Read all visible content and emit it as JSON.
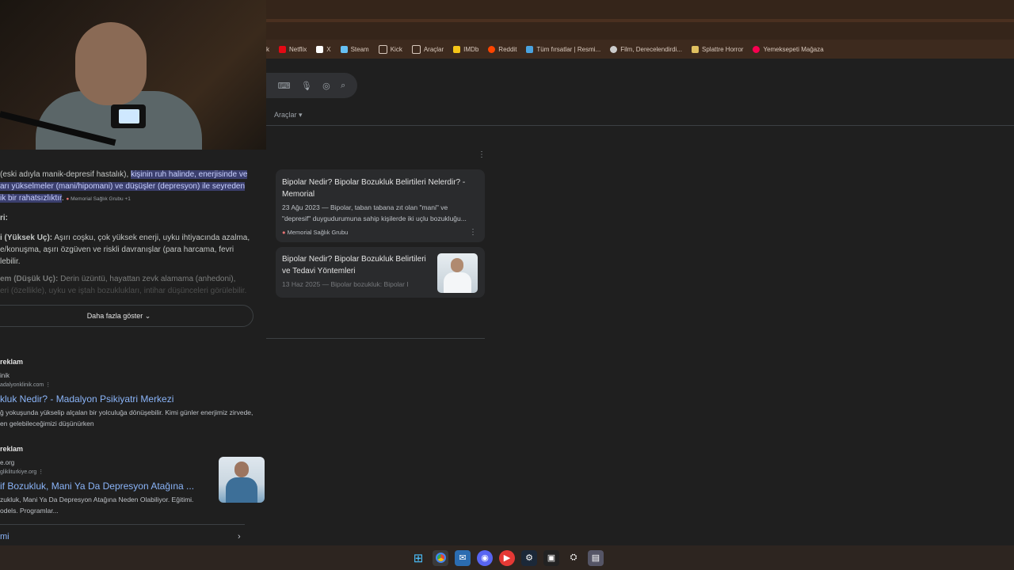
{
  "bookmarks": [
    {
      "label": "k",
      "color": "#d9c9bd"
    },
    {
      "label": "Netflix",
      "color": "#e50914"
    },
    {
      "label": "X",
      "color": "#ffffff"
    },
    {
      "label": "Steam",
      "color": "#66c0f4"
    },
    {
      "label": "Kick",
      "color": "#53fc18"
    },
    {
      "label": "Araçlar",
      "color": "#d9c9bd"
    },
    {
      "label": "IMDb",
      "color": "#f5c518"
    },
    {
      "label": "Reddit",
      "color": "#ff4500"
    },
    {
      "label": "Tüm fırsatlar | Resmi...",
      "color": "#4aa3df"
    },
    {
      "label": "Film, Derecelendirdi...",
      "color": "#cccccc"
    },
    {
      "label": "Splattre Horror",
      "color": "#e0c060"
    },
    {
      "label": "Yemeksepeti Mağaza",
      "color": "#fa0050"
    }
  ],
  "search": {
    "tools_label": "Araçlar",
    "icons": [
      "keyboard-icon",
      "mic-icon",
      "camera-icon",
      "search-icon"
    ]
  },
  "overview": {
    "line1_plain": "(eski adıyla manik-depresif hastalık), ",
    "line1_hl": "kişinin ruh halinde, enerjisinde ve",
    "line2_hl": "arı yükselmeler (mani/hipomani) ve düşüşler (depresyon) ile seyreden",
    "line3_hl": "ik bir rahatsızlıktır",
    "source_chip": "Memorial Sağlık Grubu +1",
    "heading": "ri:",
    "mania_label": "i (Yüksek Uç):",
    "mania_text": " Aşırı coşku, çok yüksek enerji, uyku ihtiyacında azalma,",
    "mania_line2": "e/konuşma, aşırı özgüven ve riskli davranışlar (para harcama, fevri",
    "mania_line3": "lebilir.",
    "dep_label": "em (Düşük Uç):",
    "dep_text": " Derin üzüntü, hayattan zevk alamama (anhedoni),",
    "dep_line2": "eri (özellikle), uyku ve iştah bozuklukları, intihar düşünceleri görülebilir.",
    "show_more": "Daha fazla göster"
  },
  "ads": [
    {
      "label": "reklam",
      "site": "inik",
      "url": "adalyonklinik.com",
      "title": "kluk Nedir? - Madalyon Psikiyatri Merkezi",
      "desc1": "ğ yokuşunda yükselip alçalan bir yolculuğa dönüşebilir. Kimi günler enerjimiz zirvede,",
      "desc2": "en gelebileceğimizi düşünürken"
    },
    {
      "label": "reklam",
      "site": "e.org",
      "url": "glikliturkiye.org",
      "title": "if Bozukluk, Mani Ya Da Depresyon Atağına ...",
      "desc1": "zukluk, Mani Ya Da Depresyon Atağına Neden Olabiliyor. Eğitimi.",
      "desc2": "odels. Programlar..."
    }
  ],
  "bottom_link": "mi",
  "right_results": [
    {
      "title": "Bipolar Nedir? Bipolar Bozukluk Belirtileri Nelerdir? - Memorial",
      "date": "23 Ağu 2023",
      "snippet": "Bipolar, taban tabana zıt olan \"mani\" ve \"depresif\" duygudurumuna sahip kişilerde iki uçlu bozukluğu...",
      "source": "Memorial Sağlık Grubu"
    },
    {
      "title": "Bipolar Nedir? Bipolar Bozukluk Belirtileri ve Tedavi Yöntemleri",
      "date": "13 Haz 2025",
      "snippet": "Bipolar bozukluk: Bipolar I",
      "source": ""
    }
  ],
  "taskbar": [
    "windows-icon",
    "chrome-icon",
    "mail-icon",
    "discord-icon",
    "youtube-icon",
    "steam-icon",
    "terminal-icon",
    "settings-icon",
    "app-icon"
  ]
}
